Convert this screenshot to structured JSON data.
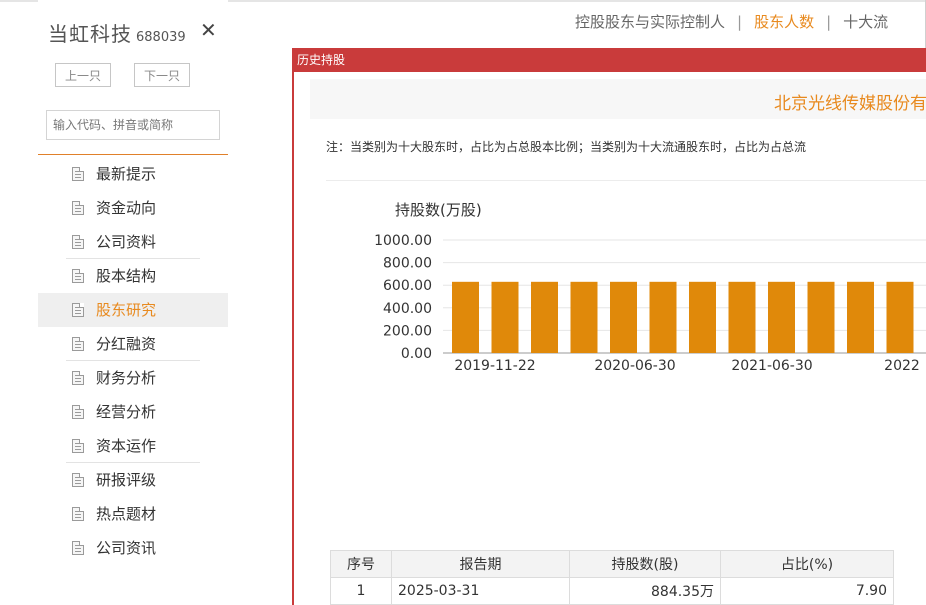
{
  "sidebar": {
    "company_name": "当虹科技",
    "stock_code": "688039",
    "close_label": "✕",
    "prev_label": "上一只",
    "next_label": "下一只",
    "search_placeholder": "输入代码、拼音或简称",
    "items": [
      {
        "label": "最新提示",
        "active": false,
        "sep": false
      },
      {
        "label": "资金动向",
        "active": false,
        "sep": false
      },
      {
        "label": "公司资料",
        "active": false,
        "sep": true
      },
      {
        "label": "股本结构",
        "active": false,
        "sep": false
      },
      {
        "label": "股东研究",
        "active": true,
        "sep": false
      },
      {
        "label": "分红融资",
        "active": false,
        "sep": true
      },
      {
        "label": "财务分析",
        "active": false,
        "sep": false
      },
      {
        "label": "经营分析",
        "active": false,
        "sep": false
      },
      {
        "label": "资本运作",
        "active": false,
        "sep": true
      },
      {
        "label": "研报评级",
        "active": false,
        "sep": false
      },
      {
        "label": "热点题材",
        "active": false,
        "sep": false
      },
      {
        "label": "公司资讯",
        "active": false,
        "sep": false
      }
    ]
  },
  "top_tabs": {
    "tab1": "控股股东与实际控制人",
    "tab2": "股东人数",
    "tab3": "十大流",
    "separator": "|"
  },
  "popup": {
    "title": "历史持股",
    "company_full_name": "北京光线传媒股份有限",
    "note": "注：当类别为十大股东时，占比为占总股本比例；当类别为十大流通股东时，占比为占总流"
  },
  "chart_data": {
    "type": "bar",
    "ylabel": "持股数(万股)",
    "ylim": [
      0,
      1000
    ],
    "yticks": [
      "1000.00",
      "800.00",
      "600.00",
      "400.00",
      "200.00",
      "0.00"
    ],
    "xtick_labels": [
      "2019-11-22",
      "2020-06-30",
      "2021-06-30",
      "2022"
    ],
    "values": [
      630,
      630,
      630,
      630,
      630,
      630,
      630,
      630,
      630,
      630,
      630,
      630
    ],
    "bar_color": "#e0890a",
    "grid": true
  },
  "table": {
    "headers": [
      "序号",
      "报告期",
      "持股数(股)",
      "占比(%)"
    ],
    "rows": [
      {
        "index": "1",
        "date": "2025-03-31",
        "shares": "884.35万",
        "ratio": "7.90"
      }
    ]
  },
  "colors": {
    "accent": "#e88a1f",
    "header_red": "#c93b3b"
  }
}
